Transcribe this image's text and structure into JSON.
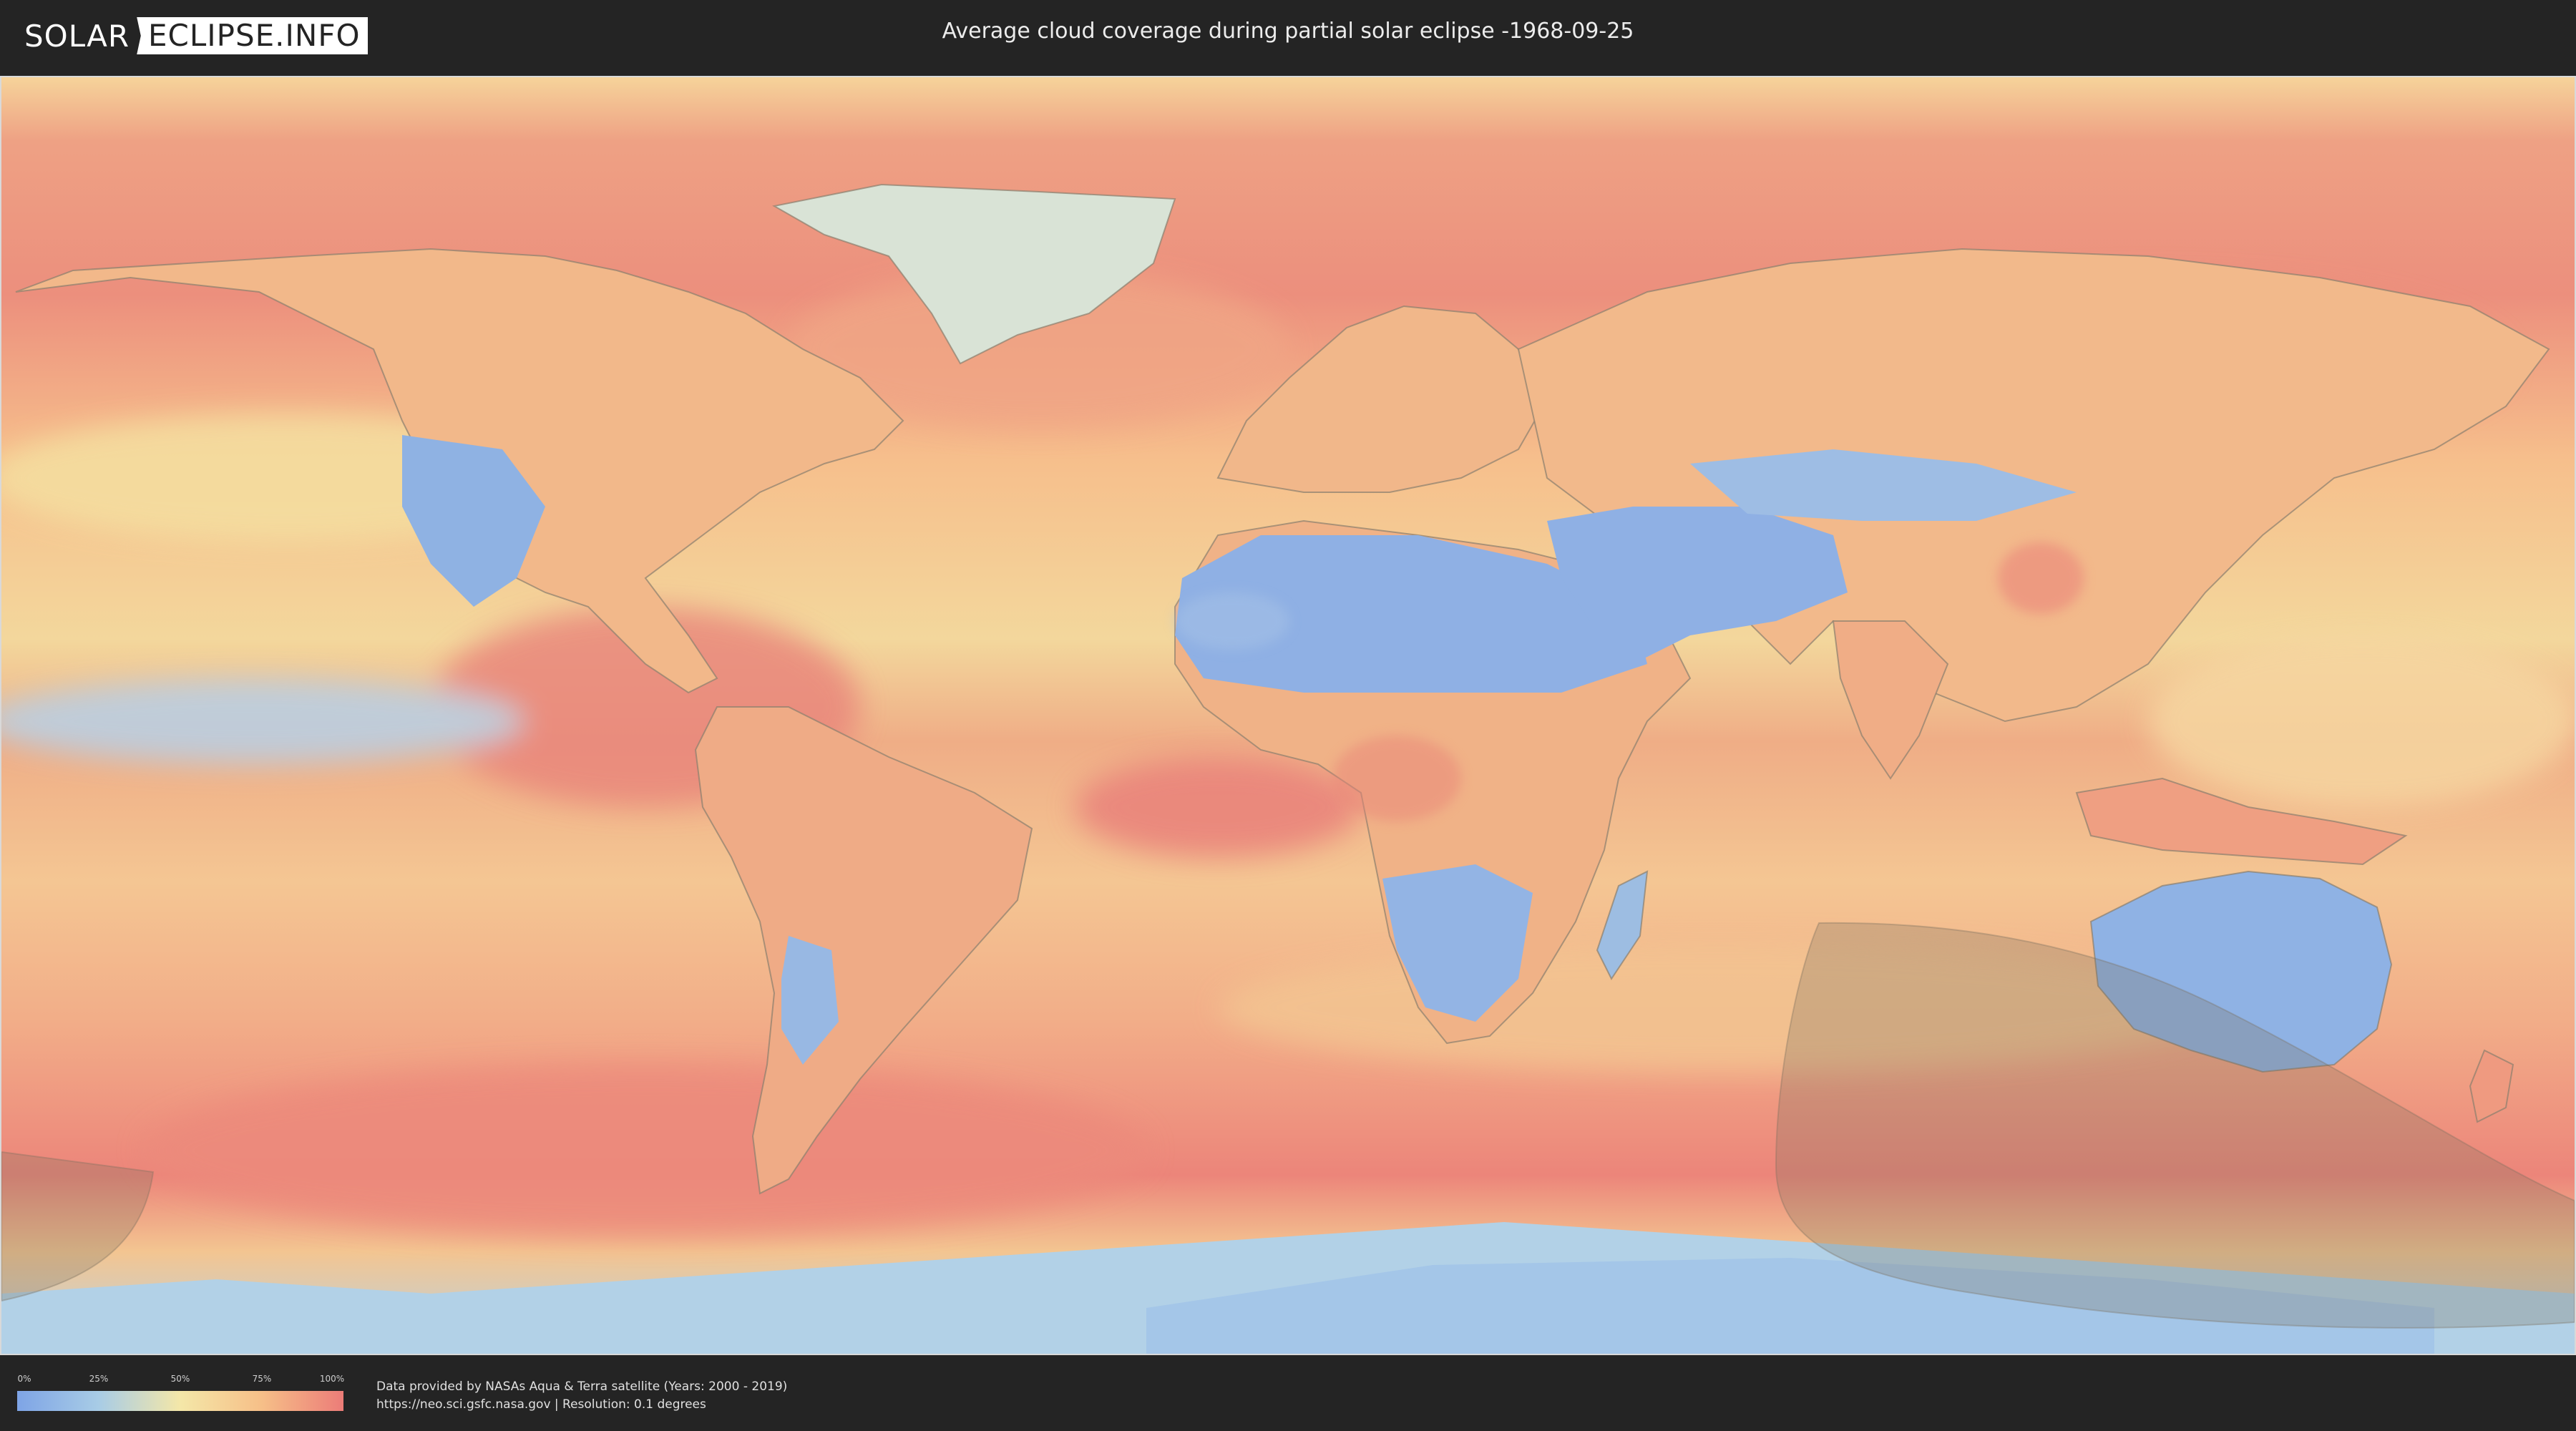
{
  "header": {
    "logo_left": "SOLAR",
    "logo_right": "ECLIPSE.INFO",
    "title": "Average cloud coverage during partial solar eclipse -1968-09-25"
  },
  "map": {
    "layer": "average cloud coverage",
    "palette": {
      "low": "#7ea4e6",
      "low_mid": "#a8cce6",
      "mid": "#f4e7a8",
      "mid_high": "#f6bf88",
      "high": "#ec7c78",
      "land_border": "#8a7f6e",
      "eclipse_shadow": "#7a6f5e"
    }
  },
  "legend": {
    "ticks": [
      "0%",
      "25%",
      "50%",
      "75%",
      "100%"
    ]
  },
  "footer": {
    "credit_line": "Data provided by NASAs Aqua & Terra satellite (Years: 2000 - 2019)",
    "source_line": "https://neo.sci.gsfc.nasa.gov | Resolution: 0.1 degrees"
  }
}
